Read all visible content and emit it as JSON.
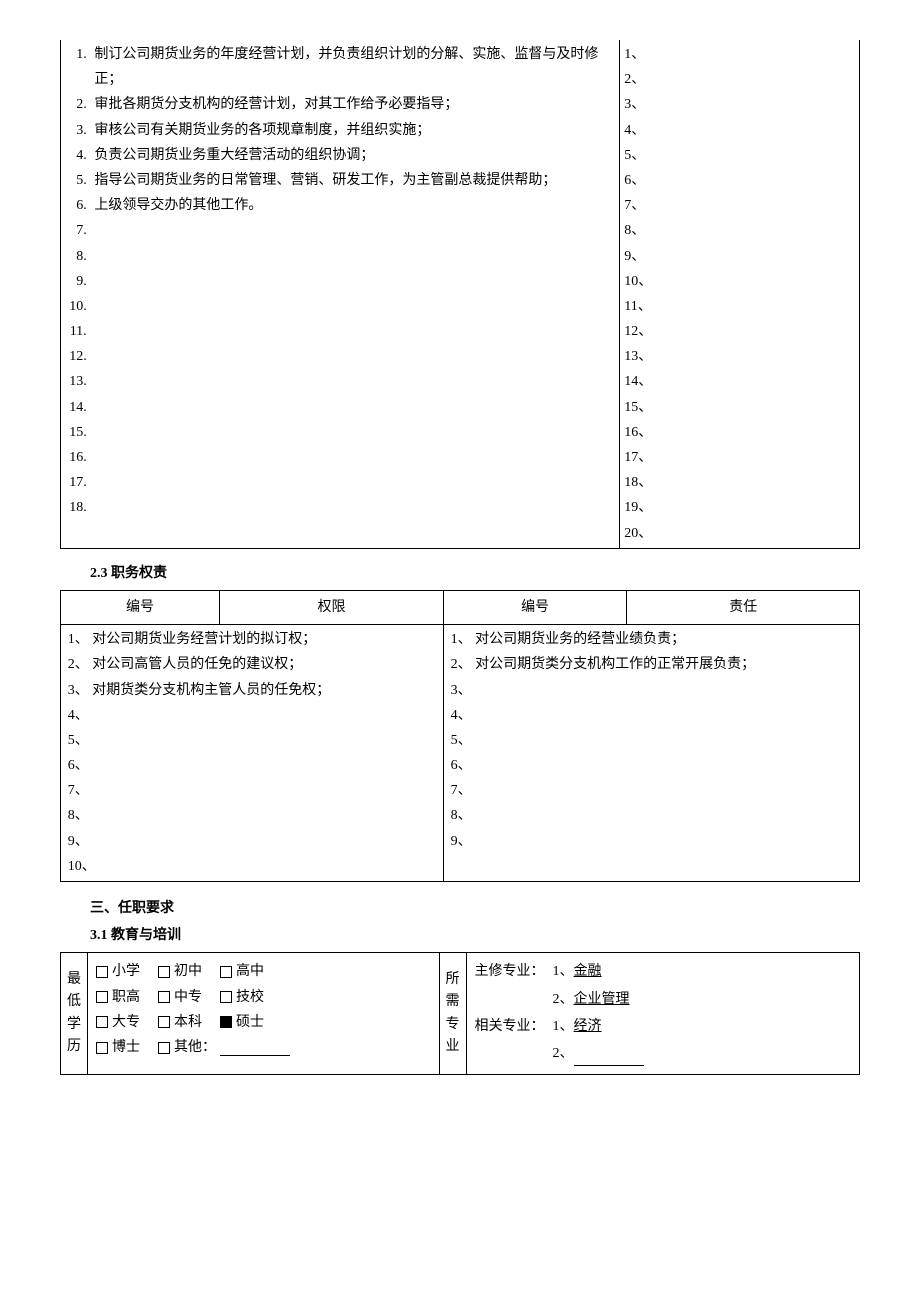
{
  "top_table": {
    "left_items": [
      "制订公司期货业务的年度经营计划，并负责组织计划的分解、实施、监督与及时修正；",
      "审批各期货分支机构的经营计划，对其工作给予必要指导；",
      "审核公司有关期货业务的各项规章制度，并组织实施；",
      "负责公司期货业务重大经营活动的组织协调；",
      "指导公司期货业务的日常管理、营销、研发工作，为主管副总裁提供帮助；",
      "上级领导交办的其他工作。"
    ],
    "left_count": 18,
    "right_count": 20
  },
  "s23": {
    "title": "2.3  职务权责",
    "h_num_l": "编号",
    "h_auth": "权限",
    "h_num_r": "编号",
    "h_resp": "责任",
    "left_items": [
      "对公司期货业务经营计划的拟订权；",
      "对公司高管人员的任免的建议权；",
      "对期货类分支机构主管人员的任免权；"
    ],
    "left_count": 10,
    "right_items": [
      "对公司期货业务的经营业绩负责；",
      "对公司期货类分支机构工作的正常开展负责；"
    ],
    "right_count": 9
  },
  "s3": {
    "title": "三、任职要求",
    "s31_title": "3.1  教育与培训",
    "edu_label": "最低学历",
    "major_label": "所需专业",
    "main_major_label": "主修专业：",
    "rel_major_label": "相关专业：",
    "main_majors": [
      "金融",
      "企业管理"
    ],
    "rel_majors": [
      "经济",
      ""
    ],
    "edu_other_label": "其他：",
    "edu_levels": [
      [
        "小学",
        "初中",
        "高中"
      ],
      [
        "职高",
        "中专",
        "技校"
      ],
      [
        "大专",
        "本科",
        "硕士"
      ],
      [
        "博士"
      ]
    ],
    "checked": "硕士"
  }
}
